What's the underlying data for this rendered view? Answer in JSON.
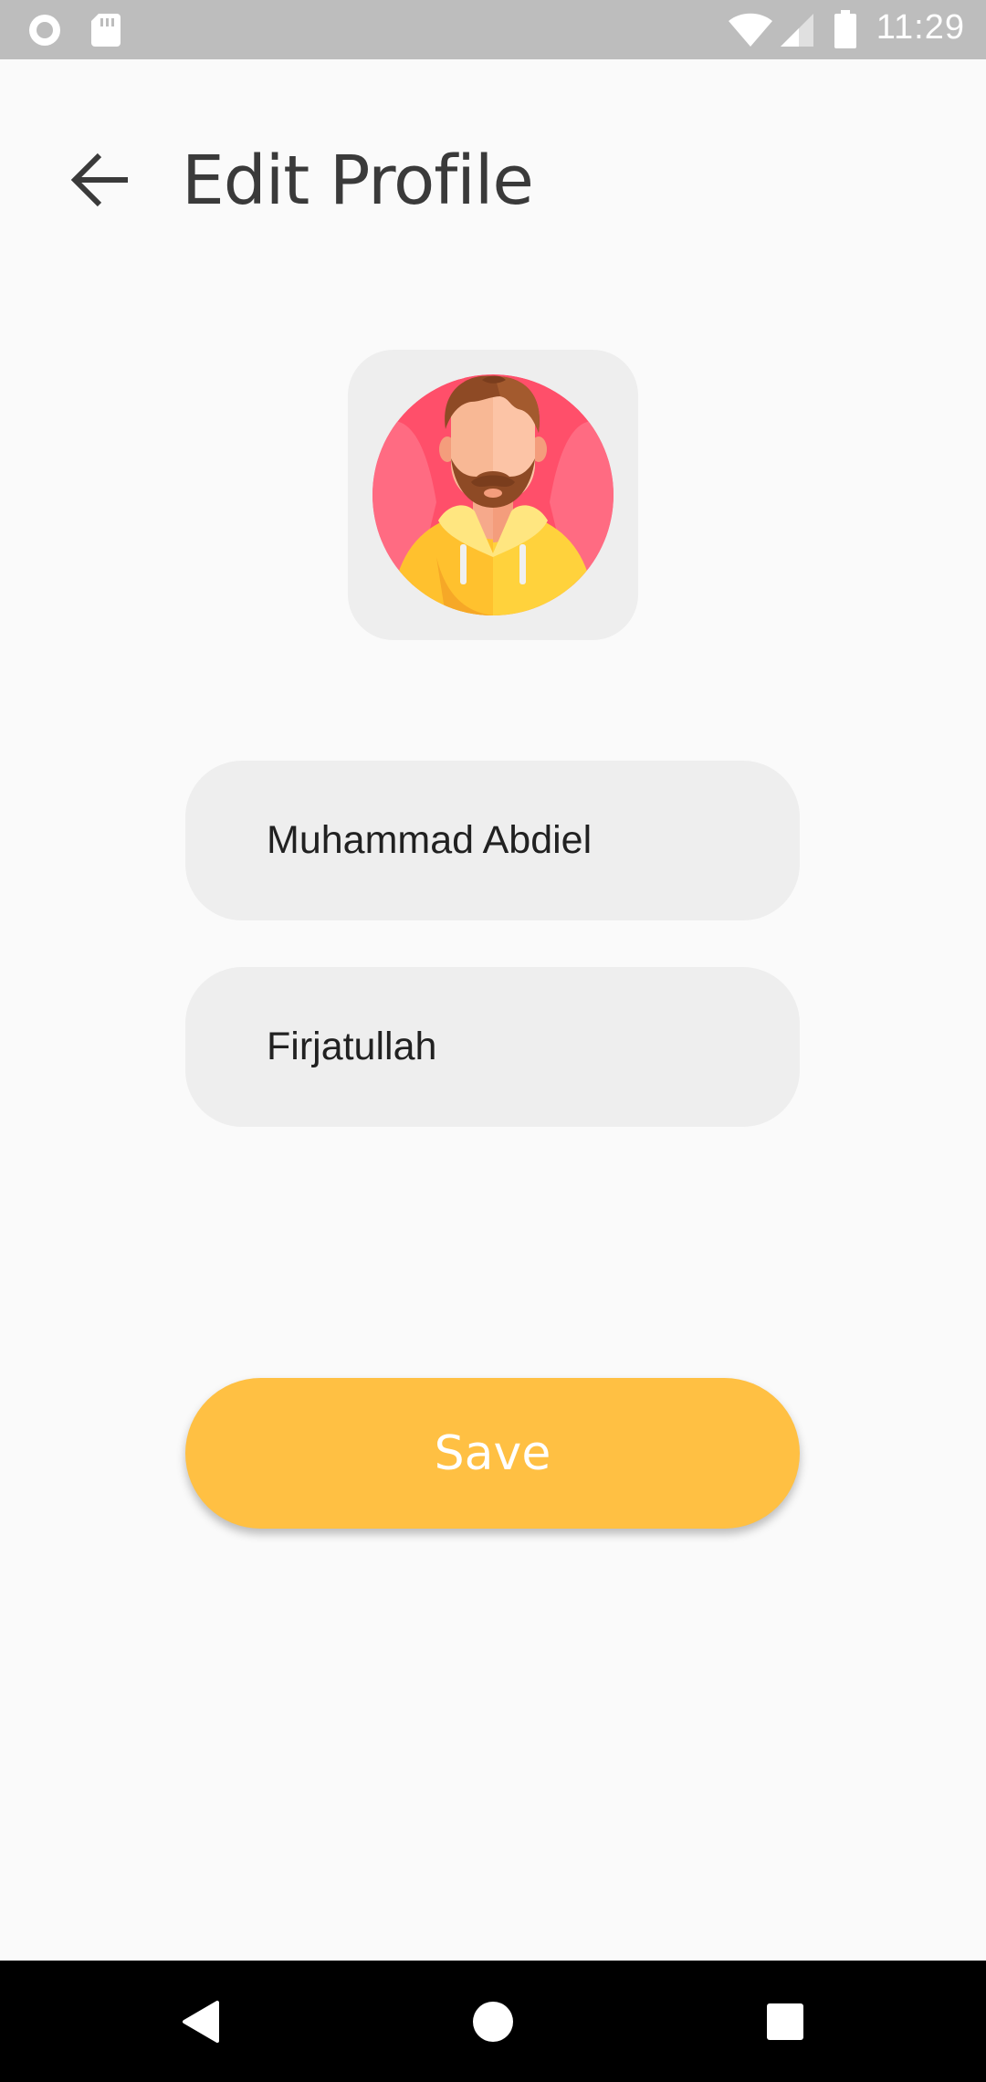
{
  "status_bar": {
    "time": "11:29",
    "left_icons": [
      "record-icon",
      "sd-card-icon"
    ],
    "right_icons": [
      "wifi-icon",
      "signal-icon",
      "battery-icon"
    ],
    "background": "#bdbdbd"
  },
  "header": {
    "title": "Edit Profile",
    "back_icon": "arrow-left-icon"
  },
  "avatar": {
    "icon": "bearded-man-avatar"
  },
  "form": {
    "first_name": "Muhammad Abdiel",
    "last_name": "Firjatullah"
  },
  "actions": {
    "save_label": "Save",
    "save_color": "#ffc043"
  },
  "nav_bar": {
    "buttons": [
      "back-triangle-icon",
      "home-circle-icon",
      "recents-square-icon"
    ]
  }
}
